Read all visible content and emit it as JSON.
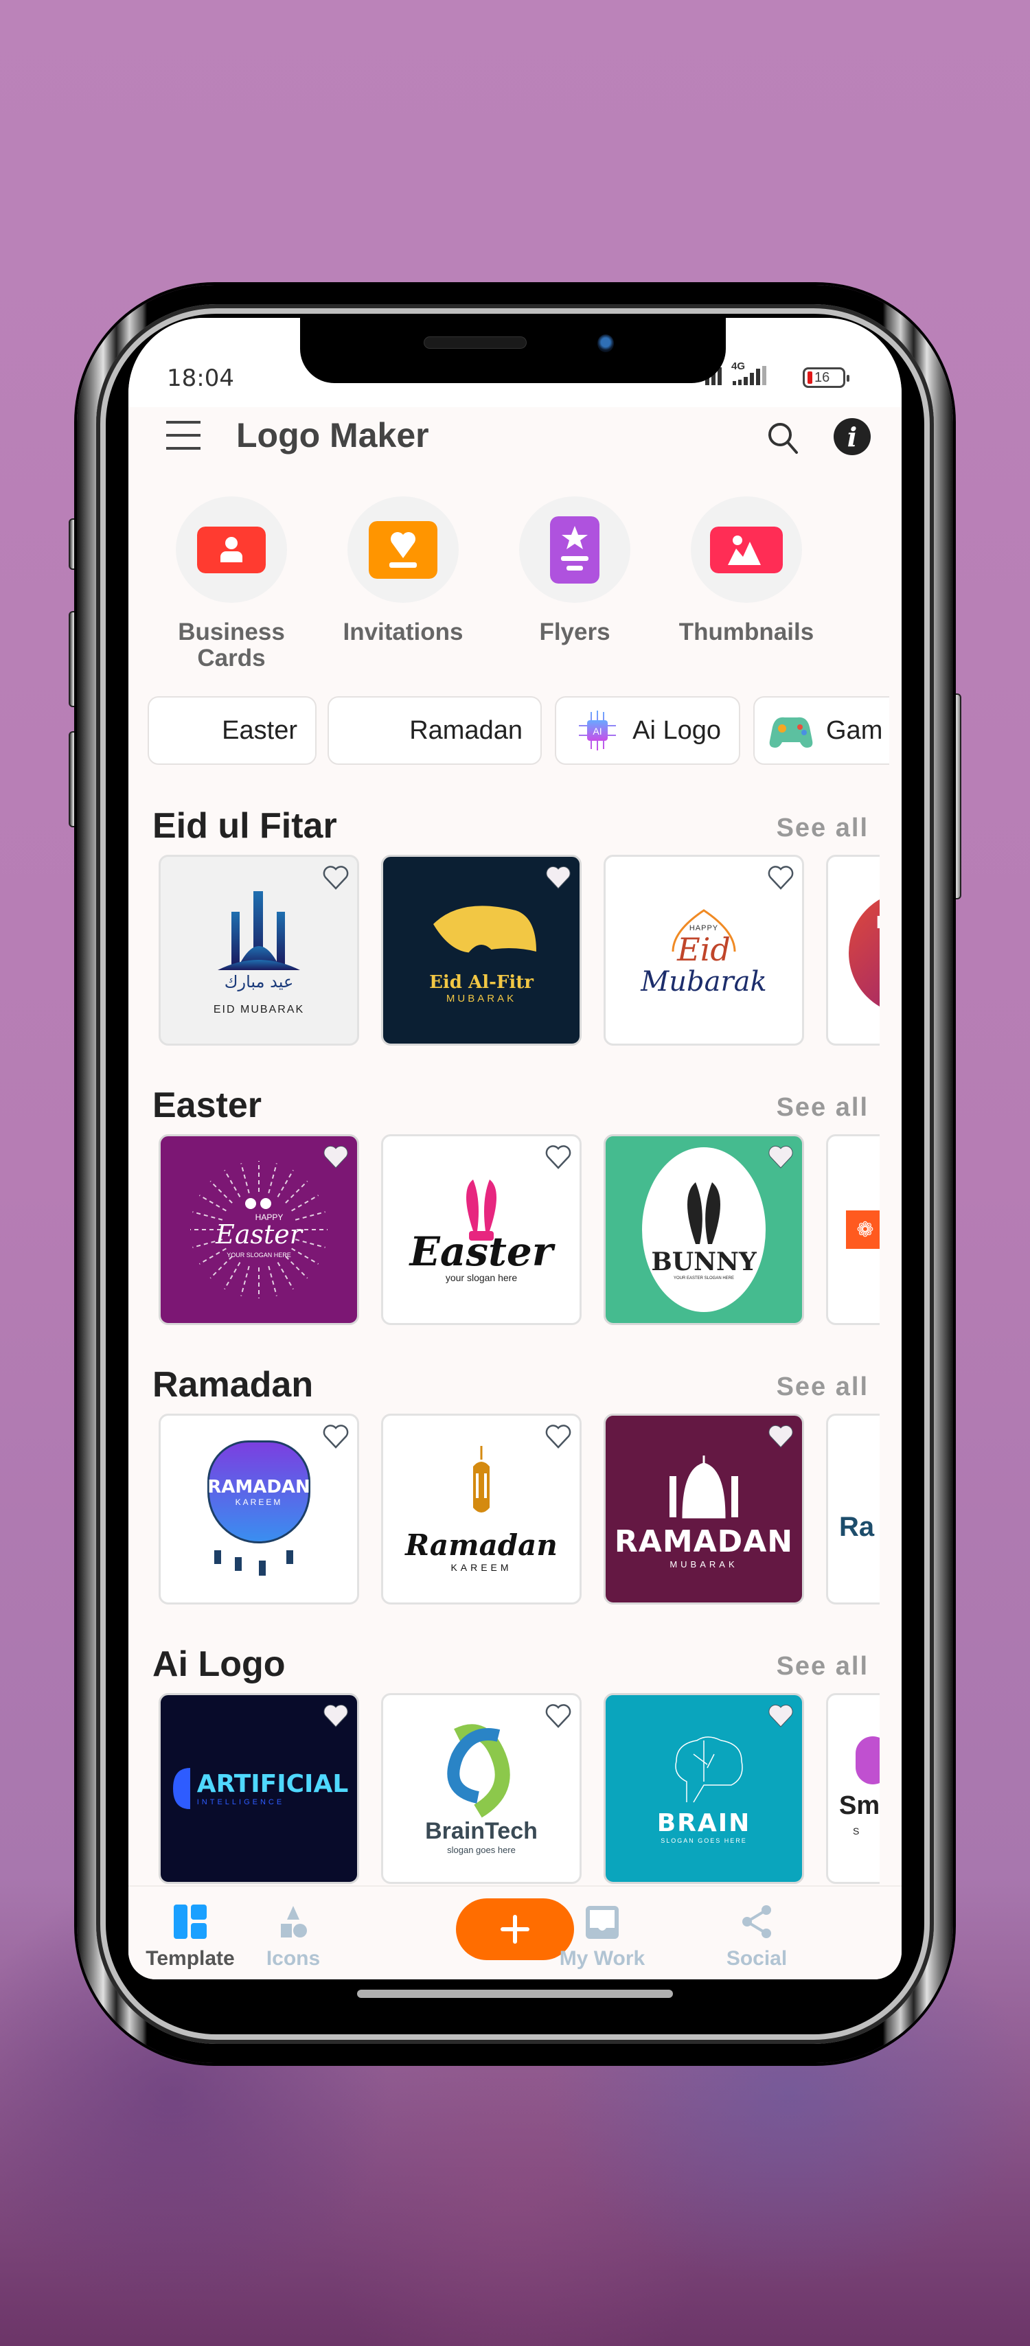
{
  "status_bar": {
    "time": "18:04",
    "network": "4G",
    "battery_level": "16",
    "battery_color": "#e01818"
  },
  "header": {
    "title": "Logo Maker",
    "menu_icon": "hamburger-menu-icon",
    "search_icon": "search-icon",
    "info_icon": "info-icon",
    "info_glyph": "i"
  },
  "categories": [
    {
      "label": "Business Cards",
      "icon": "business-card-icon",
      "color": "#ff3b30"
    },
    {
      "label": "Invitations",
      "icon": "invitation-icon",
      "color": "#ff9500"
    },
    {
      "label": "Flyers",
      "icon": "flyer-icon",
      "color": "#af52de"
    },
    {
      "label": "Thumbnails",
      "icon": "thumbnail-icon",
      "color": "#ff2d55"
    }
  ],
  "chips": [
    {
      "label": "Easter"
    },
    {
      "label": "Ramadan"
    },
    {
      "label": "Ai Logo",
      "icon": "ai-chip-icon"
    },
    {
      "label": "Gam",
      "icon": "gamepad-icon"
    }
  ],
  "sections": [
    {
      "title": "Eid ul Fitar",
      "see_all": "See all",
      "cards": [
        {
          "text1": "عيد مبارك",
          "text2": "EID MUBARAK",
          "bg": "#f1f1f1"
        },
        {
          "text1": "Eid Al-Fitr",
          "text2": "MUBARAK",
          "bg": "#0b1f33"
        },
        {
          "text1": "HAPPY",
          "text2": "Eid",
          "text3": "Mubarak",
          "bg": "#ffffff"
        },
        {
          "text1": "E",
          "bg": "#ffffff"
        }
      ]
    },
    {
      "title": "Easter",
      "see_all": "See all",
      "cards": [
        {
          "text1": "HAPPY",
          "text2": "Easter",
          "text3": "YOUR SLOGAN HERE",
          "bg": "#7c1774"
        },
        {
          "text1": "Easter",
          "text2": "your slogan here",
          "bg": "#ffffff"
        },
        {
          "text1": "BUNNY",
          "text2": "YOUR EASTER SLOGAN HERE",
          "bg": "#45bb8f"
        },
        {
          "text1": "",
          "bg": "#ffffff"
        }
      ]
    },
    {
      "title": "Ramadan",
      "see_all": "See all",
      "cards": [
        {
          "text1": "RAMADAN",
          "text2": "KAREEM",
          "bg": "#ffffff"
        },
        {
          "text1": "Ramadan",
          "text2": "KAREEM",
          "bg": "#ffffff"
        },
        {
          "text1": "RAMADAN",
          "text2": "MUBARAK",
          "bg": "#641843"
        },
        {
          "text1": "Ra",
          "bg": "#ffffff"
        }
      ]
    },
    {
      "title": "Ai Logo",
      "see_all": "See all",
      "cards": [
        {
          "text1": "ARTIFICIAL",
          "text2": "INTELLIGENCE",
          "bg": "#080b2a"
        },
        {
          "text1": "BrainTech",
          "text2": "slogan goes here",
          "bg": "#ffffff"
        },
        {
          "text1": "BRAIN",
          "text2": "SLOGAN GOES HERE",
          "bg": "#0aa5bd"
        },
        {
          "text1": "Sm",
          "text2": "S",
          "bg": "#ffffff"
        }
      ]
    }
  ],
  "bottom_nav": {
    "items": [
      {
        "label": "Template",
        "icon": "template-icon",
        "active": true
      },
      {
        "label": "Icons",
        "icon": "shapes-icon",
        "active": false
      },
      {
        "label": "My Work",
        "icon": "inbox-icon",
        "active": false
      },
      {
        "label": "Social",
        "icon": "share-icon",
        "active": false
      }
    ],
    "fab_icon": "plus-icon",
    "fab_color": "#ff6d00",
    "active_color": "#1aa0ff",
    "inactive_color": "#b1c4d3"
  }
}
